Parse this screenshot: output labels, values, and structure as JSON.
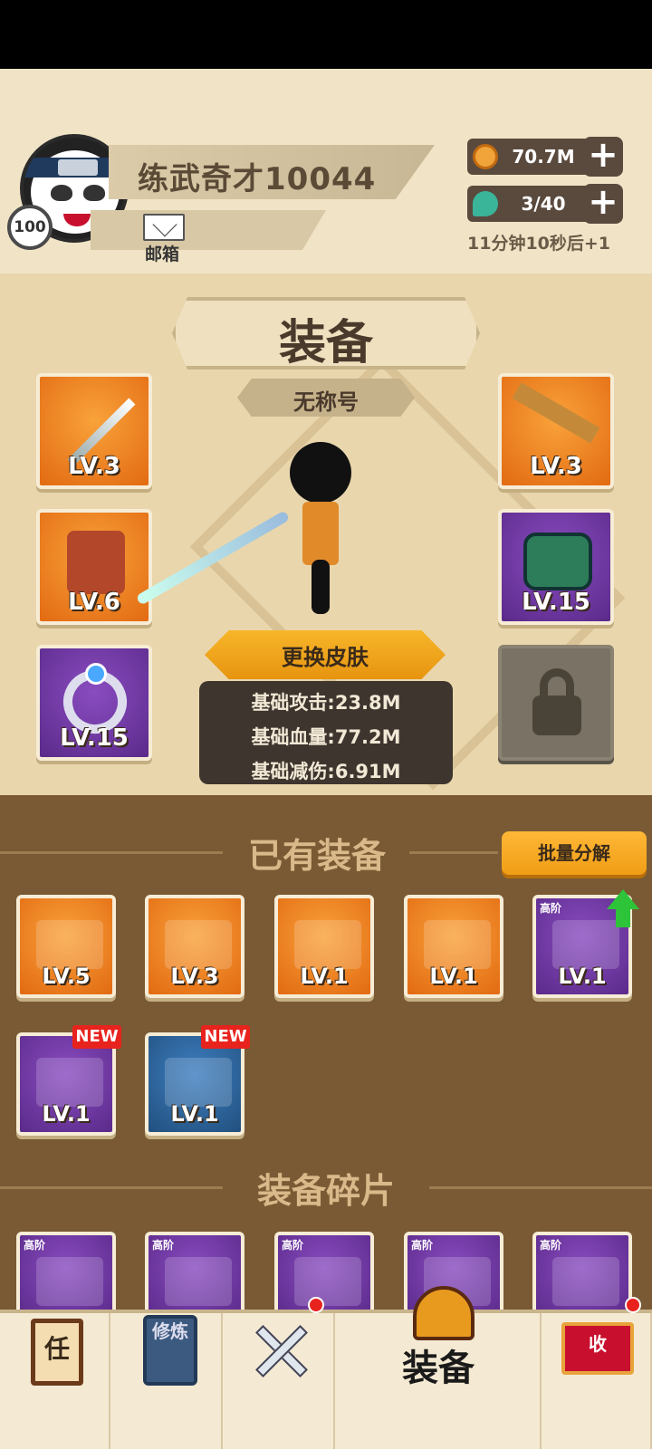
{
  "player": {
    "name": "练武奇才10044",
    "level": "100",
    "mail_label": "邮箱"
  },
  "resources": {
    "coins": "70.7M",
    "energy": "3/40",
    "energy_timer": "11分钟10秒后+1",
    "plus": "+"
  },
  "equip_panel": {
    "title": "装备",
    "title_tag": "无称号",
    "change_skin_button": "更换皮肤",
    "stats": {
      "attack": "基础攻击:23.8M",
      "hp": "基础血量:77.2M",
      "defense": "基础减伤:6.91M"
    },
    "slots": {
      "weapon": "LV.3",
      "armor": "LV.6",
      "ring": "LV.15",
      "hat": "LV.3",
      "boots": "LV.15"
    }
  },
  "owned": {
    "title": "已有装备",
    "batch_button": "批量分解",
    "items": [
      {
        "level": "LV.5",
        "rarity": "orange"
      },
      {
        "level": "LV.3",
        "rarity": "orange"
      },
      {
        "level": "LV.1",
        "rarity": "orange"
      },
      {
        "level": "LV.1",
        "rarity": "orange"
      },
      {
        "level": "LV.1",
        "rarity": "purple",
        "tier": "高阶"
      },
      {
        "level": "LV.1",
        "rarity": "purple",
        "badge": "NEW"
      },
      {
        "level": "LV.1",
        "rarity": "blue",
        "badge": "NEW"
      }
    ]
  },
  "fragments": {
    "title": "装备碎片",
    "tier": "高阶"
  },
  "nav": {
    "task": "任",
    "cultivate": "修炼",
    "equip": "装备",
    "collect": "收"
  },
  "colors": {
    "orange_rarity": "#f08a24",
    "purple_rarity": "#6a36a0",
    "blue_rarity": "#2e6aa8",
    "button_gold": "#f5a623"
  }
}
